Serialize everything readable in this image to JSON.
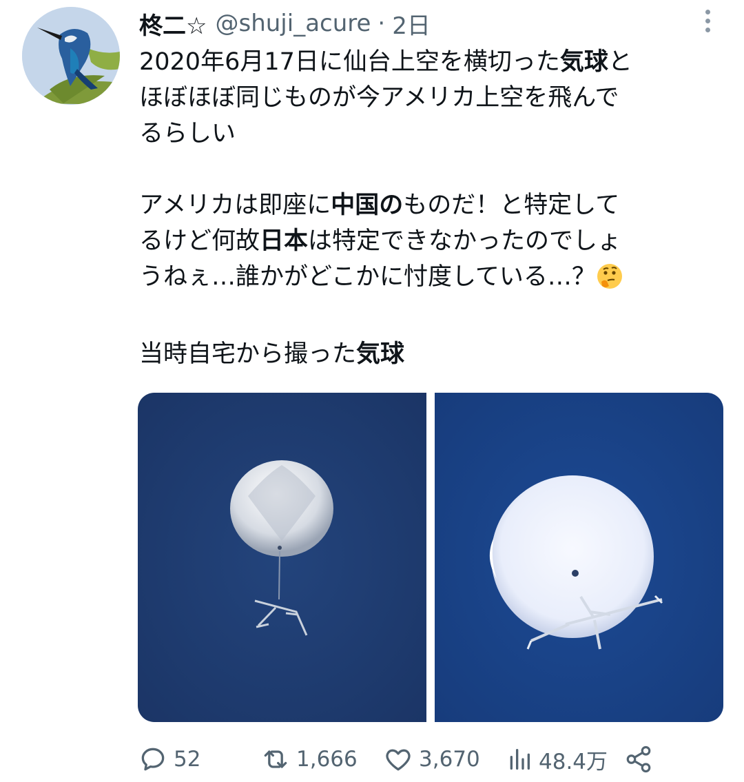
{
  "author": {
    "display_name": "柊二☆",
    "handle": "@shuji_acure",
    "separator": "·",
    "time": "2日"
  },
  "tweet": {
    "line1_a": "2020年6月17日に仙台上空を横切った",
    "line1_b": "気球",
    "line1_c": "と",
    "line2": "ほぼほぼ同じものが今アメリカ上空を飛んで",
    "line3": "るらしい",
    "p2_a": "アメリカは即座に",
    "p2_b": "中国の",
    "p2_c": "ものだ！と特定して",
    "p2_d": "るけど何故",
    "p2_e": "日本",
    "p2_f": "は特定できなかったのでしょ",
    "p2_g": "うねぇ…誰かがどこかに忖度している…？",
    "p3_a": "当時自宅から撮った",
    "p3_b": "気球"
  },
  "actions": {
    "replies": "52",
    "retweets": "1,666",
    "likes": "3,670",
    "views": "48.4万"
  },
  "colors": {
    "text": "#0f1419",
    "secondary": "#536471",
    "sky_left": "#1d3a6e",
    "sky_right": "#1a4388"
  }
}
